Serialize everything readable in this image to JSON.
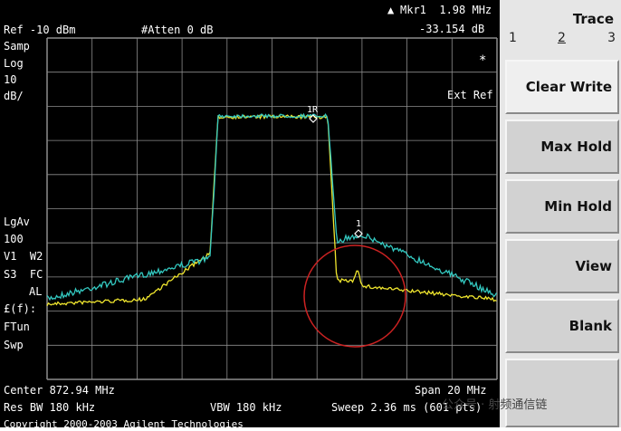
{
  "header": {
    "ref": "Ref -10 dBm",
    "atten": "#Atten 0 dB",
    "marker_label": "Mkr1  1.98 MHz",
    "marker_value": "-33.154 dB",
    "marker_delta_glyph": "▲"
  },
  "left_panel": {
    "samp": "Samp",
    "log": "Log",
    "scale_value": "10",
    "scale_unit": "dB/",
    "lgav": "LgAv",
    "avg_count": "100",
    "v1w2": "V1  W2",
    "s3fc": "S3  FC",
    "al": "AL",
    "ef": "£(f):",
    "ftun": "FTun",
    "swp": "Swp"
  },
  "right_labels": {
    "star": "*",
    "ext_ref": "Ext Ref"
  },
  "markers": {
    "ref_marker": "1R",
    "marker1": "1"
  },
  "footer": {
    "center": "Center 872.94 MHz",
    "span": "Span 20 MHz",
    "res_bw": "Res BW 180 kHz",
    "vbw": "VBW 180 kHz",
    "sweep": "Sweep 2.36 ms (601 pts)",
    "copyright": "Copyright 2000-2003 Agilent Technologies"
  },
  "softkeys": {
    "title": "Trace",
    "trace_numbers": [
      "1",
      "2",
      "3"
    ],
    "selected_trace": "2",
    "keys": [
      "Clear Write",
      "Max Hold",
      "Min Hold",
      "View",
      "Blank"
    ],
    "selected_key": "Clear Write"
  },
  "watermark": {
    "text": "公众号 · 射频通信链"
  },
  "colors": {
    "trace_cyan": "#33c8c0",
    "trace_yellow": "#f0e62e",
    "grid": "#8c8c8c",
    "annotation_circle": "#cc2222"
  }
}
